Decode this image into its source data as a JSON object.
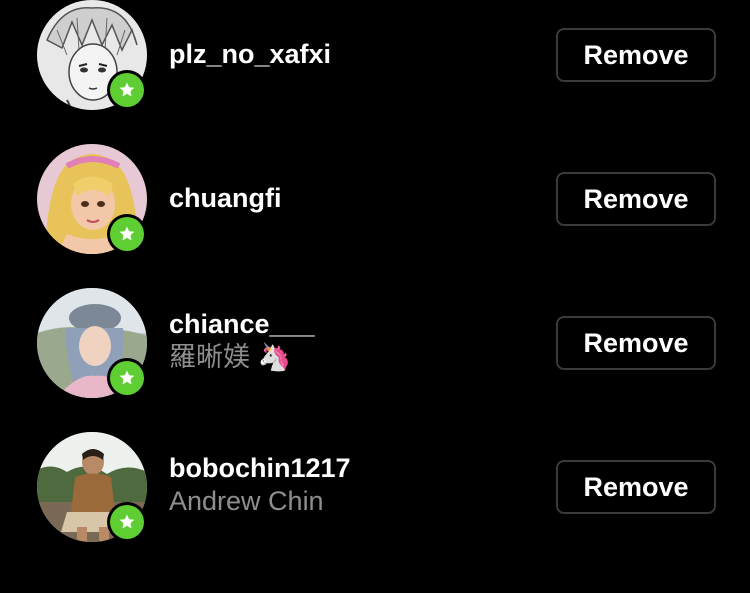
{
  "followers": [
    {
      "username": "plz_no_xafxi",
      "full_name": "",
      "button_label": "Remove",
      "badge_icon": "star-icon"
    },
    {
      "username": "chuangfi",
      "full_name": "",
      "button_label": "Remove",
      "badge_icon": "star-icon"
    },
    {
      "username": "chiance___",
      "full_name": "羅晰媄 🦄",
      "button_label": "Remove",
      "badge_icon": "star-icon"
    },
    {
      "username": "bobochin1217",
      "full_name": "Andrew Chin",
      "button_label": "Remove",
      "badge_icon": "star-icon"
    }
  ],
  "colors": {
    "background": "#000000",
    "badge_green": "#5fce32",
    "secondary_text": "#8e8e8e",
    "button_border": "#3a3a3a"
  }
}
